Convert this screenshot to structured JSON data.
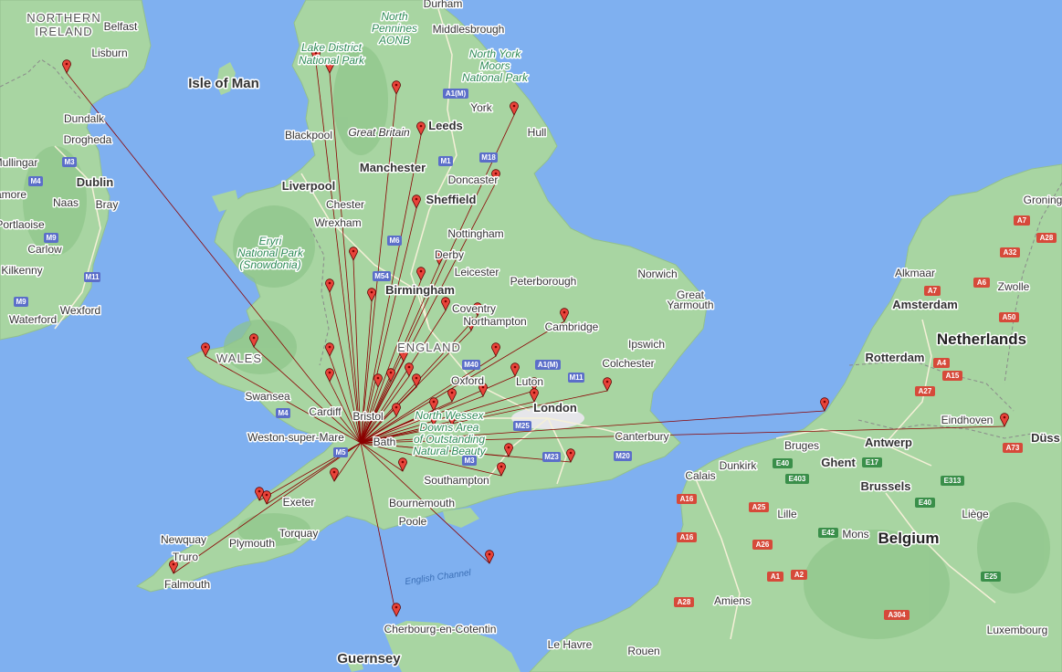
{
  "map": {
    "colors": {
      "sea": "#7fb0f0",
      "land": "#a8d5a2",
      "land_dark": "#8ec48a",
      "route_line": "#8b0000",
      "pin": "#e8443a",
      "pin_outline": "#5a0000",
      "motorway_shield": "#5b6ec9",
      "a_road_shield_nl": "#d64a3a"
    },
    "hub_pin": "bath",
    "labels": {
      "countries": {
        "wales": "WALES",
        "england": "ENGLAND",
        "northern_ireland_1": "NORTHERN",
        "northern_ireland_2": "IRELAND",
        "netherlands": "Netherlands",
        "belgium": "Belgium"
      },
      "islands": {
        "isle_of_man": "Isle of Man",
        "guernsey": "Guernsey"
      },
      "sea": {
        "english_channel": "English Channel"
      },
      "parks": {
        "lake_district_1": "Lake District",
        "lake_district_2": "National Park",
        "north_pennines_1": "North",
        "north_pennines_2": "Pennines",
        "north_pennines_3": "AONB",
        "north_york_moors_1": "North York",
        "north_york_moors_2": "Moors",
        "north_york_moors_3": "National Park",
        "eryri_1": "Eryri",
        "eryri_2": "National Park",
        "eryri_3": "(Snowdonia)",
        "north_wessex_1": "North Wessex",
        "north_wessex_2": "Downs Area",
        "north_wessex_3": "of Outstanding",
        "north_wessex_4": "Natural Beauty",
        "great_britain": "Great Britain"
      },
      "cities_big": {
        "manchester": "Manchester",
        "liverpool": "Liverpool",
        "leeds": "Leeds",
        "sheffield": "Sheffield",
        "birmingham": "Birmingham",
        "london": "London",
        "bristol": "Bristol",
        "cardiff": "Cardiff",
        "dublin": "Dublin",
        "amsterdam": "Amsterdam",
        "rotterdam": "Rotterdam",
        "brussels": "Brussels",
        "antwerp": "Antwerp",
        "ghent": "Ghent"
      },
      "cities": {
        "belfast": "Belfast",
        "lisburn": "Lisburn",
        "durham": "Durham",
        "middlesbrough": "Middlesbrough",
        "york": "York",
        "hull": "Hull",
        "blackpool": "Blackpool",
        "doncaster": "Doncaster",
        "chester": "Chester",
        "wrexham": "Wrexham",
        "nottingham": "Nottingham",
        "derby": "Derby",
        "leicester": "Leicester",
        "peterborough": "Peterborough",
        "norwich": "Norwich",
        "great_yarmouth_1": "Great",
        "great_yarmouth_2": "Yarmouth",
        "coventry": "Coventry",
        "northampton": "Northampton",
        "cambridge": "Cambridge",
        "ipswich": "Ipswich",
        "colchester": "Colchester",
        "luton": "Luton",
        "oxford": "Oxford",
        "swansea": "Swansea",
        "weston": "Weston-super-Mare",
        "bath": "Bath",
        "canterbury": "Canterbury",
        "southampton": "Southampton",
        "bournemouth": "Bournemouth",
        "poole": "Poole",
        "exeter": "Exeter",
        "torquay": "Torquay",
        "plymouth": "Plymouth",
        "newquay": "Newquay",
        "truro": "Truro",
        "falmouth": "Falmouth",
        "cherbourg": "Cherbourg-en-Cotentin",
        "dundalk": "Dundalk",
        "drogheda": "Drogheda",
        "mullingar": "Mullingar",
        "naas": "Naas",
        "bray": "Bray",
        "portlaoise": "Portlaoise",
        "carlow": "Carlow",
        "kilkenny": "Kilkenny",
        "wexford": "Wexford",
        "waterford": "Waterford",
        "amore": "amore",
        "calais": "Calais",
        "dunkirk": "Dunkirk",
        "bruges": "Bruges",
        "lille": "Lille",
        "mons": "Mons",
        "liege": "Liège",
        "amiens": "Amiens",
        "rouen": "Rouen",
        "le_havre": "Le Havre",
        "luxembourg": "Luxembourg",
        "eindhoven": "Eindhoven",
        "alkmaar": "Alkmaar",
        "zwolle": "Zwolle",
        "groningen": "Groning",
        "dusseldorf": "Düss"
      },
      "roads": {
        "a1m_north": "A1(M)",
        "m1": "M1",
        "m18": "M18",
        "m6": "M6",
        "m54": "M54",
        "m40": "M40",
        "a1m_south": "A1(M)",
        "m11": "M11",
        "m25": "M25",
        "m23": "M23",
        "m20": "M20",
        "m4": "M4",
        "m5": "M5",
        "m3": "M3",
        "ire_m3": "M3",
        "ire_m4": "M4",
        "ire_m9": "M9",
        "ire_m11": "M11",
        "ire_m9b": "M9",
        "a7": "A7",
        "a28": "A28",
        "a32": "A32",
        "a6": "A6",
        "a50": "A50",
        "a7b": "A7",
        "a4": "A4",
        "a15": "A15",
        "a27": "A27",
        "a16": "A16",
        "a25": "A25",
        "e40": "E40",
        "e17": "E17",
        "e403": "E403",
        "e313": "E313",
        "e42": "E42",
        "e40b": "E40",
        "a26": "A26",
        "a1": "A1",
        "a2": "A2",
        "a28b": "A28",
        "a304": "A304",
        "e25": "E25",
        "a73": "A73",
        "a16b": "A16"
      }
    }
  }
}
